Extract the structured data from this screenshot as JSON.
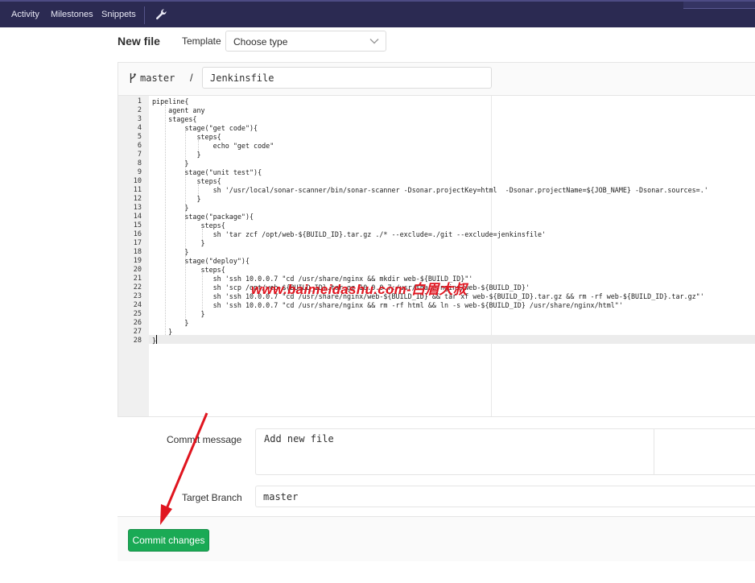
{
  "nav": {
    "items": [
      "Activity",
      "Milestones",
      "Snippets"
    ],
    "settings_icon": "wrench-icon"
  },
  "page": {
    "title": "New file",
    "template_label": "Template",
    "template_value": "Choose type"
  },
  "editor": {
    "branch": "master",
    "path_separator": "/",
    "filename": "Jenkinsfile",
    "line_numbers": [
      "1",
      "2",
      "3",
      "4",
      "5",
      "6",
      "7",
      "8",
      "9",
      "10",
      "11",
      "12",
      "13",
      "14",
      "15",
      "16",
      "17",
      "18",
      "19",
      "20",
      "21",
      "22",
      "23",
      "24",
      "25",
      "26",
      "27",
      "28"
    ],
    "lines": [
      "pipeline{",
      "    agent any",
      "    stages{",
      "        stage(\"get code\"){",
      "           steps{",
      "               echo \"get code\"",
      "           }",
      "        }",
      "        stage(\"unit test\"){",
      "           steps{",
      "               sh '/usr/local/sonar-scanner/bin/sonar-scanner -Dsonar.projectKey=html  -Dsonar.projectName=${JOB_NAME} -Dsonar.sources=.'",
      "           }",
      "        }",
      "        stage(\"package\"){",
      "            steps{",
      "               sh 'tar zcf /opt/web-${BUILD_ID}.tar.gz ./* --exclude=./git --exclude=jenkinsfile'",
      "            }",
      "        }",
      "        stage(\"deploy\"){",
      "            steps{",
      "               sh 'ssh 10.0.0.7 \"cd /usr/share/nginx && mkdir web-${BUILD_ID}\"'",
      "               sh 'scp /opt/web-${BUILD_ID}.tar.gz 10.0.0.7:/usr/share/nginx/web-${BUILD_ID}'",
      "               sh 'ssh 10.0.0.7 \"cd /usr/share/nginx/web-${BUILD_ID} && tar xf web-${BUILD_ID}.tar.gz && rm -rf web-${BUILD_ID}.tar.gz\"'",
      "               sh 'ssh 10.0.0.7 \"cd /usr/share/nginx && rm -rf html && ln -s web-${BUILD_ID} /usr/share/nginx/html\"'",
      "            }",
      "        }",
      "    }",
      "}"
    ]
  },
  "watermark": "www.baimeidashu.com-白眉大叔",
  "commit": {
    "message_label": "Commit message",
    "message_value": "Add new file",
    "branch_label": "Target Branch",
    "branch_value": "master",
    "button_label": "Commit changes"
  },
  "colors": {
    "nav_bg": "#2b2a52",
    "button": "#1aaa55",
    "annotation_arrow": "#e0151f"
  }
}
